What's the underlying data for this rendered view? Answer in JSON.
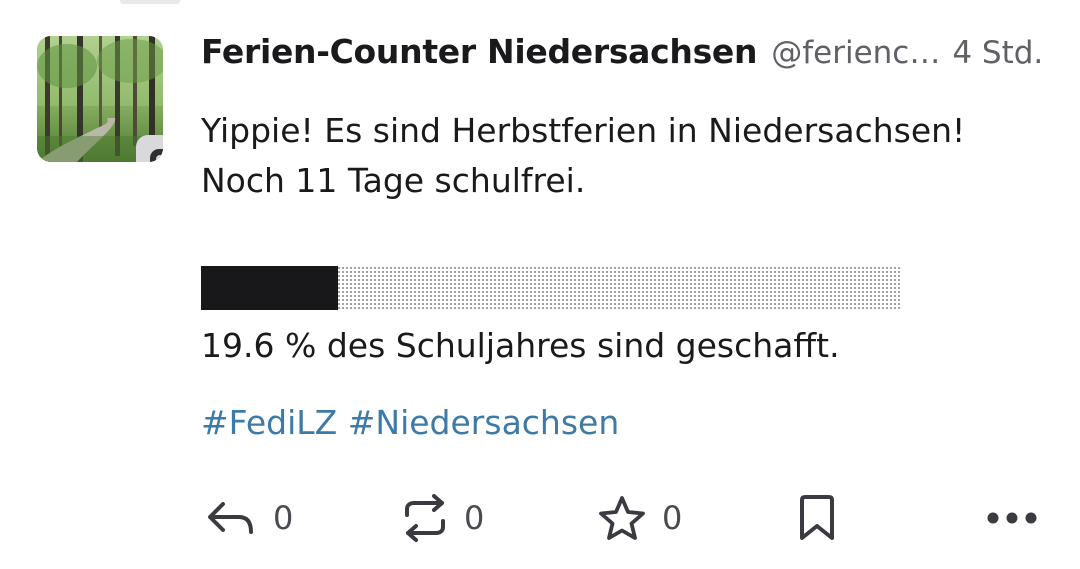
{
  "post": {
    "display_name": "Ferien-Counter Niedersachsen",
    "handle": "@ferienc…",
    "timestamp": "4 Std.",
    "content_line1": "Yippie! Es sind Herbstferien in Niedersachsen!",
    "content_line2": "Noch 11 Tage schulfrei.",
    "progress_fraction": 0.196,
    "progress_text": "19.6 % des Schuljahres sind geschafft.",
    "hashtags": [
      "#FediLZ",
      "#Niedersachsen"
    ]
  },
  "actions": {
    "reply_icon": "reply-icon",
    "reply_count": "0",
    "boost_icon": "boost-icon",
    "boost_count": "0",
    "favourite_icon": "star-icon",
    "favourite_count": "0",
    "bookmark_icon": "bookmark-icon",
    "more_icon": "more-horizontal-icon"
  },
  "avatar": {
    "image": "forest path",
    "badge_icon": "bot-icon"
  },
  "colors": {
    "text": "#1a1a1c",
    "secondary_text": "#606066",
    "hashtag": "#3d7aa8",
    "progress_fill": "#18181b",
    "icon": "#3a3a40"
  }
}
